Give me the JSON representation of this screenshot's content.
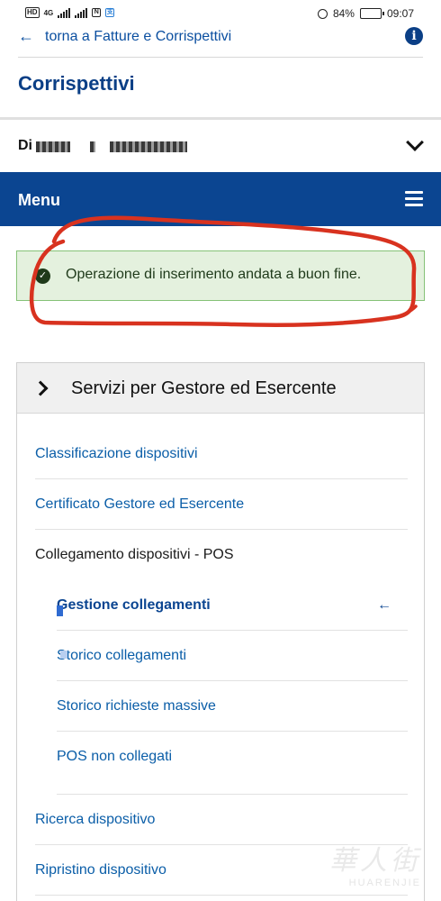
{
  "status_bar": {
    "hd_label": "HD",
    "network_label": "4G",
    "battery": "84%",
    "battery_level": 0.84,
    "time": "09:07"
  },
  "header": {
    "back_label": "torna a Fatture e Corrispettivi",
    "page_title": "Corrispettivi"
  },
  "selector": {
    "prefix": "Di"
  },
  "menu": {
    "label": "Menu"
  },
  "alert": {
    "message": "Operazione di inserimento andata a buon fine."
  },
  "panel": {
    "title": "Servizi per Gestore ed Esercente",
    "items": [
      {
        "label": "Classificazione dispositivi"
      },
      {
        "label": "Certificato Gestore ed Esercente"
      },
      {
        "label": "Collegamento dispositivi - POS"
      },
      {
        "label": "Gestione collegamenti"
      },
      {
        "label": "Storico collegamenti"
      },
      {
        "label": "Storico richieste massive"
      },
      {
        "label": "POS non collegati"
      },
      {
        "label": "Ricerca dispositivo"
      },
      {
        "label": "Ripristino dispositivo"
      }
    ]
  },
  "watermark": {
    "chars": "華人街",
    "latin": "HUARENJIE"
  },
  "colors": {
    "brand_blue": "#0b4591",
    "link_blue": "#0b5ea8",
    "success_bg": "#e4f1de",
    "annotation_red": "#d8321f",
    "active_arrow": "#d9662b"
  }
}
